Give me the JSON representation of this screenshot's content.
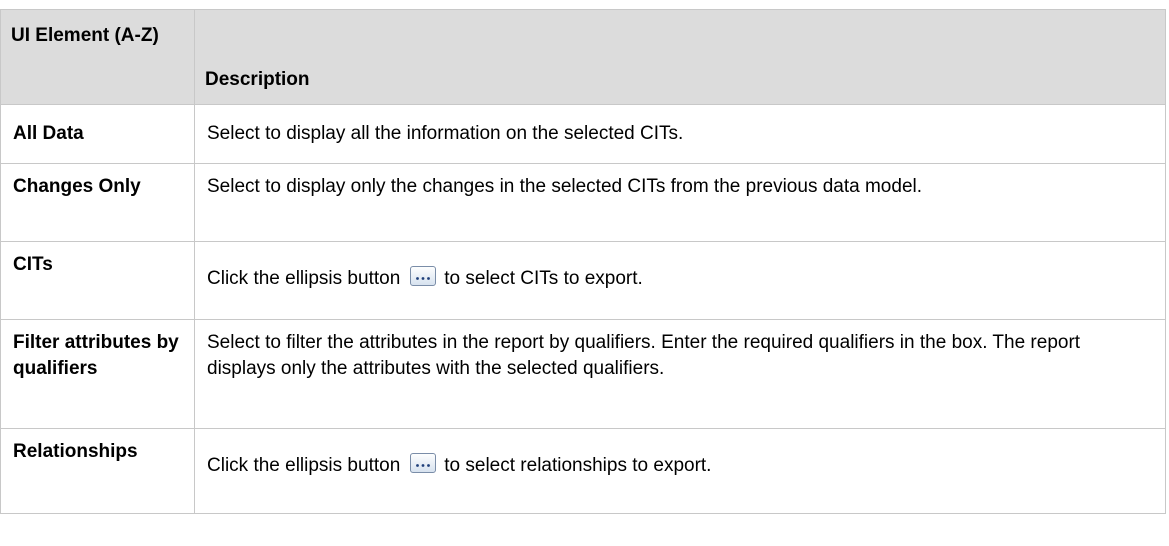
{
  "table": {
    "headers": {
      "element": "UI Element (A-Z)",
      "description": "Description"
    },
    "rows": [
      {
        "element": "All Data",
        "description": "Select to display all the information on the selected CITs."
      },
      {
        "element": "Changes Only",
        "description": "Select to display only the changes in the selected CITs from the previous data model."
      },
      {
        "element": "CITs",
        "desc_before": "Click the ellipsis button",
        "button_icon": "ellipsis-button-icon",
        "desc_after": "to select CITs to export."
      },
      {
        "element": "Filter attributes by qualifiers",
        "description": "Select to filter the attributes in the report by qualifiers. Enter the required qualifiers in the box. The report displays only the attributes with the selected qualifiers."
      },
      {
        "element": "Relationships",
        "desc_before": "Click the ellipsis button",
        "button_icon": "ellipsis-button-icon",
        "desc_after": "to select relationships to export."
      }
    ]
  },
  "colors": {
    "header_bg": "#dcdcdc",
    "border": "#c8c8c8",
    "button_border": "#7a8da8"
  }
}
